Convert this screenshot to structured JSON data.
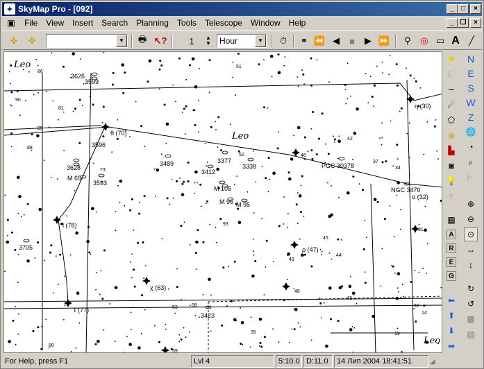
{
  "window": {
    "title": "SkyMap Pro - [092]",
    "minimize": "_",
    "maximize": "□",
    "close": "×"
  },
  "menu": [
    "File",
    "View",
    "Insert",
    "Search",
    "Planning",
    "Tools",
    "Telescope",
    "Window",
    "Help"
  ],
  "toolbar": {
    "step": "1",
    "unit": "Hour"
  },
  "map": {
    "constellation_labels": [
      "Leo",
      "Leo",
      "Leo"
    ],
    "objects": [
      {
        "label": "3626"
      },
      {
        "label": "3599"
      },
      {
        "label": "θ (70)"
      },
      {
        "label": "3596"
      },
      {
        "label": "3489"
      },
      {
        "label": "3377"
      },
      {
        "label": "3338"
      },
      {
        "label": "3412"
      },
      {
        "label": "3628"
      },
      {
        "label": "M 65"
      },
      {
        "label": "3593"
      },
      {
        "label": "M 105"
      },
      {
        "label": "M 96"
      },
      {
        "label": "M 95"
      },
      {
        "label": "PGC 30378"
      },
      {
        "label": "NGC 3470"
      },
      {
        "label": "α (32)"
      },
      {
        "label": "ι (78)"
      },
      {
        "label": "3705"
      },
      {
        "label": "ρ (47)"
      },
      {
        "label": "χ (63)"
      },
      {
        "label": "τ (77)"
      },
      {
        "label": "3423"
      },
      {
        "label": "η (30)"
      }
    ],
    "star_numbers": [
      "86",
      "51",
      "90",
      "81",
      "85",
      "88",
      "73",
      "52",
      "46",
      "42",
      "37",
      "34",
      "93",
      "45",
      "44",
      "49",
      "48",
      "31",
      "43",
      "53",
      "58",
      "14",
      "19",
      "80",
      "35",
      "59",
      "92"
    ]
  },
  "right_panel": {
    "directions": [
      "N",
      "E",
      "S",
      "W",
      "Z"
    ],
    "letters": [
      "A",
      "R",
      "E",
      "G"
    ]
  },
  "status": {
    "help": "For Help, press F1",
    "level": "Lvl 4",
    "ra": "5:10.0",
    "dec": "D:11.0",
    "datetime": "14 Лип 2004 18:41:51"
  }
}
